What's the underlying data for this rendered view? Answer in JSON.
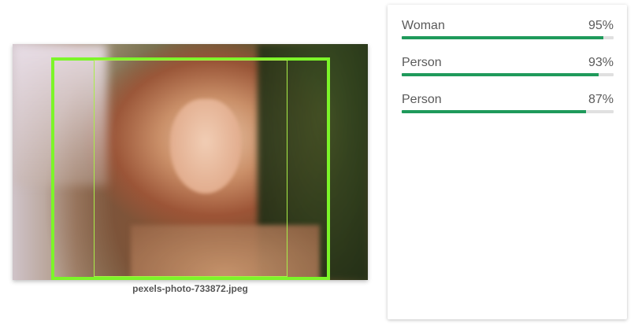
{
  "image": {
    "filename": "pexels-photo-733872.jpeg"
  },
  "labels": [
    {
      "name": "Woman",
      "percent_text": "95%",
      "score": 0.95
    },
    {
      "name": "Person",
      "percent_text": "93%",
      "score": 0.93
    },
    {
      "name": "Person",
      "percent_text": "87%",
      "score": 0.87
    }
  ],
  "colors": {
    "bar_fill": "#1f9a5b",
    "bar_track": "#e0e0e0",
    "bbox_primary": "#7cf529",
    "bbox_secondary": "#a9ee48"
  }
}
